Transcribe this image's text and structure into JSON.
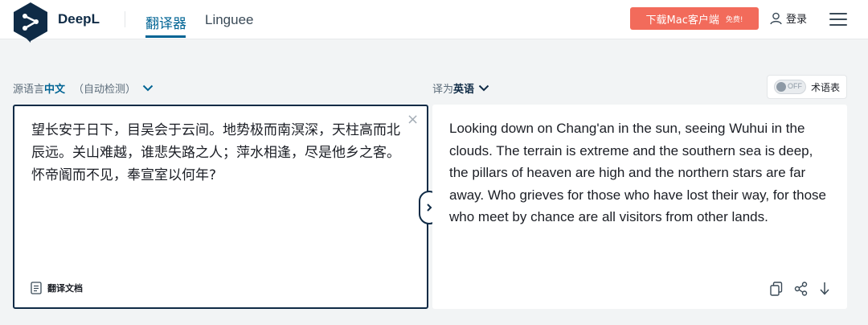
{
  "header": {
    "brand": "DeepL",
    "nav": {
      "translator": "翻译器",
      "linguee": "Linguee"
    },
    "download": {
      "label": "下载Mac客户端",
      "badge": "免费!"
    },
    "login": "登录"
  },
  "source": {
    "label_prefix": "源语言",
    "language": "中文",
    "auto_detect": "（自动检测）",
    "text": "望长安于日下，目吴会于云间。地势极而南溟深，天柱高而北辰远。关山难越，谁悲失路之人；萍水相逢，尽是他乡之客。怀帝阍而不见，奉宣室以何年?",
    "translate_document": "翻译文档"
  },
  "target": {
    "label_prefix": "译为",
    "language": "英语",
    "text": "Looking down on Chang'an in the sun, seeing Wuhui in the clouds. The terrain is extreme and the southern sea is deep, the pillars of heaven are high and the northern stars are far away. Who grieves for those who have lost their way, for those who meet by chance are all visitors from other lands."
  },
  "glossary": {
    "toggle_state": "OFF",
    "label": "术语表"
  },
  "colors": {
    "brand": "#0f2b46",
    "accent": "#006494",
    "download": "#f26b5b"
  }
}
